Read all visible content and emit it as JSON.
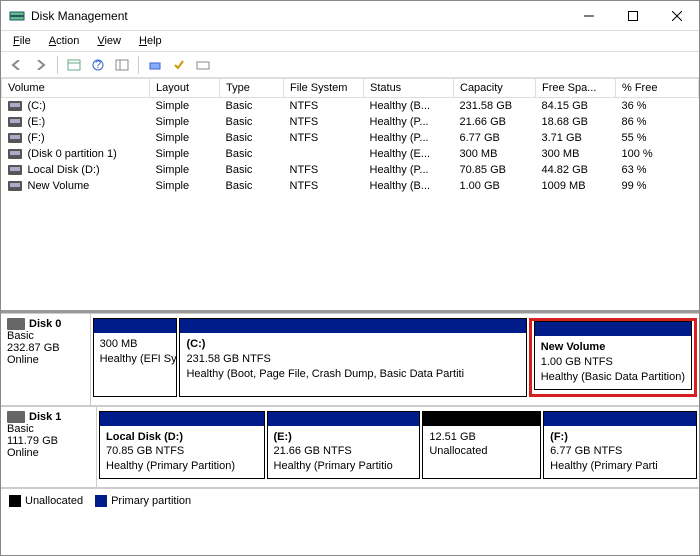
{
  "window": {
    "title": "Disk Management"
  },
  "menubar": {
    "file": "File",
    "action": "Action",
    "view": "View",
    "help": "Help"
  },
  "columns": {
    "volume": "Volume",
    "layout": "Layout",
    "type": "Type",
    "fs": "File System",
    "status": "Status",
    "capacity": "Capacity",
    "free": "Free Spa...",
    "pfree": "% Free"
  },
  "volumes": [
    {
      "name": "(C:)",
      "layout": "Simple",
      "type": "Basic",
      "fs": "NTFS",
      "status": "Healthy (B...",
      "cap": "231.58 GB",
      "free": "84.15 GB",
      "pfree": "36 %"
    },
    {
      "name": "(E:)",
      "layout": "Simple",
      "type": "Basic",
      "fs": "NTFS",
      "status": "Healthy (P...",
      "cap": "21.66 GB",
      "free": "18.68 GB",
      "pfree": "86 %"
    },
    {
      "name": "(F:)",
      "layout": "Simple",
      "type": "Basic",
      "fs": "NTFS",
      "status": "Healthy (P...",
      "cap": "6.77 GB",
      "free": "3.71 GB",
      "pfree": "55 %"
    },
    {
      "name": "(Disk 0 partition 1)",
      "layout": "Simple",
      "type": "Basic",
      "fs": "",
      "status": "Healthy (E...",
      "cap": "300 MB",
      "free": "300 MB",
      "pfree": "100 %"
    },
    {
      "name": "Local Disk (D:)",
      "layout": "Simple",
      "type": "Basic",
      "fs": "NTFS",
      "status": "Healthy (P...",
      "cap": "70.85 GB",
      "free": "44.82 GB",
      "pfree": "63 %"
    },
    {
      "name": "New Volume",
      "layout": "Simple",
      "type": "Basic",
      "fs": "NTFS",
      "status": "Healthy (B...",
      "cap": "1.00 GB",
      "free": "1009 MB",
      "pfree": "99 %"
    }
  ],
  "disks": [
    {
      "name": "Disk 0",
      "type": "Basic",
      "size": "232.87 GB",
      "state": "Online",
      "parts": [
        {
          "title": "",
          "line1": "300 MB",
          "line2": "Healthy (EFI System Parti",
          "kind": "primary",
          "flex": 12
        },
        {
          "title": "(C:)",
          "line1": "231.58 GB NTFS",
          "line2": "Healthy (Boot, Page File, Crash Dump, Basic Data Partiti",
          "kind": "primary",
          "flex": 50
        },
        {
          "title": "New Volume",
          "line1": "1.00 GB NTFS",
          "line2": "Healthy (Basic Data Partition)",
          "kind": "primary",
          "flex": 22,
          "highlight": true
        }
      ]
    },
    {
      "name": "Disk 1",
      "type": "Basic",
      "size": "111.79 GB",
      "state": "Online",
      "parts": [
        {
          "title": "Local Disk  (D:)",
          "line1": "70.85 GB NTFS",
          "line2": "Healthy (Primary Partition)",
          "kind": "primary",
          "flex": 28
        },
        {
          "title": "(E:)",
          "line1": "21.66 GB NTFS",
          "line2": "Healthy (Primary Partitio",
          "kind": "primary",
          "flex": 26
        },
        {
          "title": "",
          "line1": "12.51 GB",
          "line2": "Unallocated",
          "kind": "unalloc",
          "flex": 20
        },
        {
          "title": "(F:)",
          "line1": "6.77 GB NTFS",
          "line2": "Healthy (Primary Parti",
          "kind": "primary",
          "flex": 26
        }
      ]
    }
  ],
  "legend": {
    "unalloc": "Unallocated",
    "primary": "Primary partition"
  }
}
